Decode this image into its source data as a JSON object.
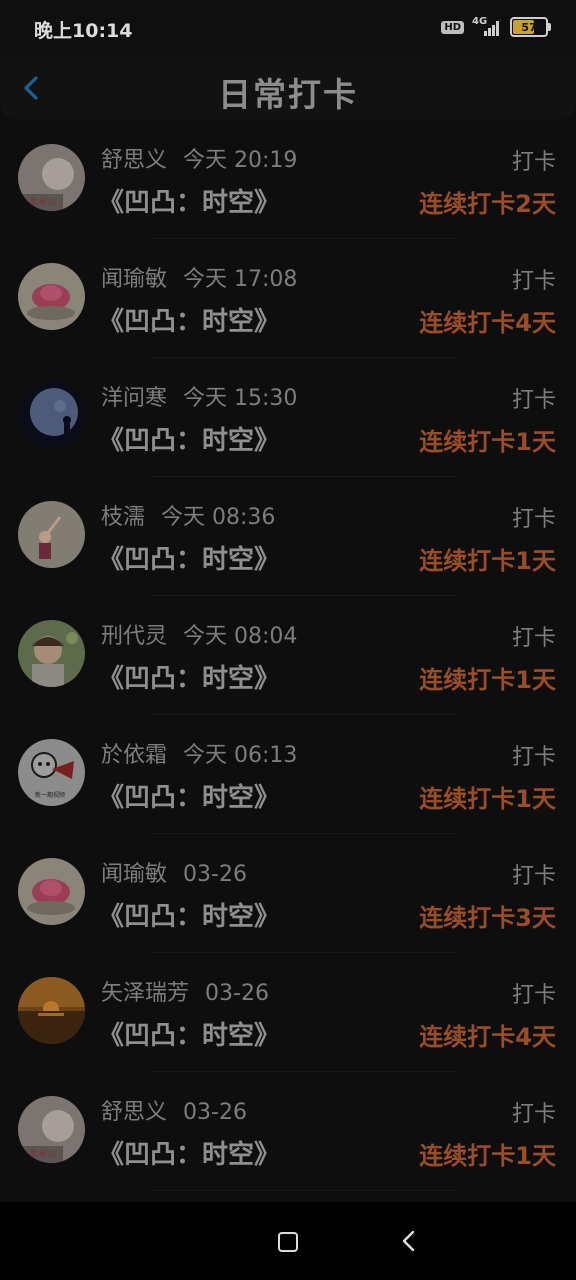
{
  "status": {
    "time": "晚上10:14",
    "hd": "HD",
    "network": "4G",
    "battery": "57",
    "battery_level": 0.57
  },
  "header": {
    "title": "日常打卡"
  },
  "entries": [
    {
      "name": "舒思义",
      "time": "今天 20:19",
      "tag": "打卡",
      "book": "《凹凸：时空》",
      "streak": "连续打卡2天"
    },
    {
      "name": "闻瑜敏",
      "time": "今天 17:08",
      "tag": "打卡",
      "book": "《凹凸：时空》",
      "streak": "连续打卡4天"
    },
    {
      "name": "洋问寒",
      "time": "今天 15:30",
      "tag": "打卡",
      "book": "《凹凸：时空》",
      "streak": "连续打卡1天"
    },
    {
      "name": "枝濡",
      "time": "今天 08:36",
      "tag": "打卡",
      "book": "《凹凸：时空》",
      "streak": "连续打卡1天"
    },
    {
      "name": "刑代灵",
      "time": "今天 08:04",
      "tag": "打卡",
      "book": "《凹凸：时空》",
      "streak": "连续打卡1天"
    },
    {
      "name": "於依霜",
      "time": "今天 06:13",
      "tag": "打卡",
      "book": "《凹凸：时空》",
      "streak": "连续打卡1天"
    },
    {
      "name": "闻瑜敏",
      "time": "03-26",
      "tag": "打卡",
      "book": "《凹凸：时空》",
      "streak": "连续打卡3天"
    },
    {
      "name": "矢泽瑞芳",
      "time": "03-26",
      "tag": "打卡",
      "book": "《凹凸：时空》",
      "streak": "连续打卡4天"
    },
    {
      "name": "舒思义",
      "time": "03-26",
      "tag": "打卡",
      "book": "《凹凸：时空》",
      "streak": "连续打卡1天"
    }
  ],
  "colors": {
    "accent": "#9a4d27",
    "back_icon": "#1f5f9a",
    "background": "#0e0e0e"
  }
}
